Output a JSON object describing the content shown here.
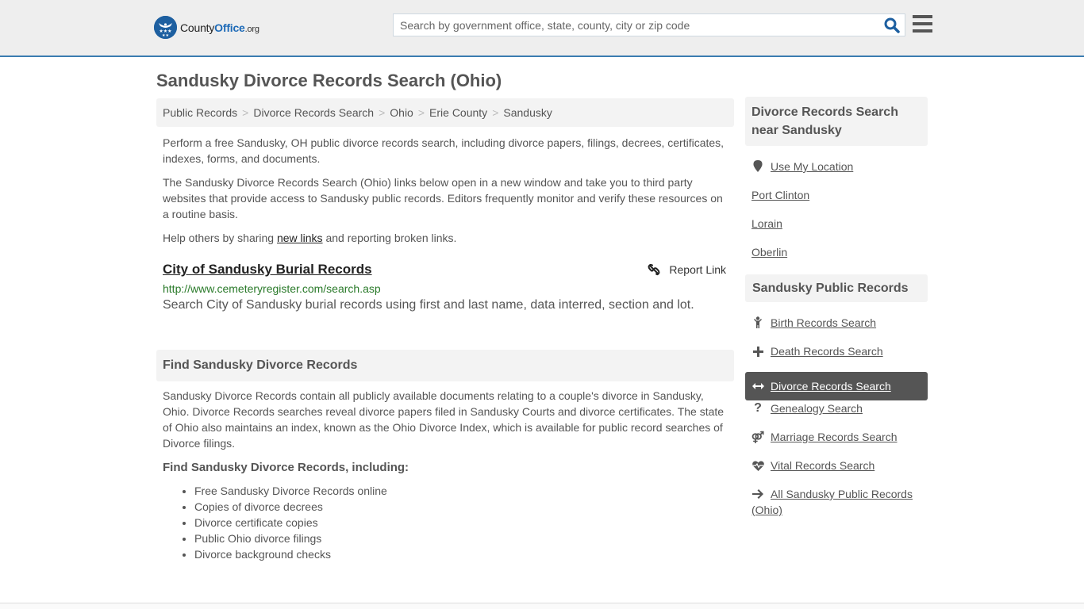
{
  "header": {
    "logo_text_1": "County",
    "logo_text_2": "Office",
    "logo_text_3": ".org",
    "search_placeholder": "Search by government office, state, county, city or zip code",
    "search_icon": "search-icon",
    "menu_icon": "hamburger-menu-icon",
    "accent_color": "#1d6ab7"
  },
  "page": {
    "title": "Sandusky Divorce Records Search (Ohio)"
  },
  "breadcrumb": [
    {
      "label": "Public Records"
    },
    {
      "label": "Divorce Records Search"
    },
    {
      "label": "Ohio"
    },
    {
      "label": "Erie County"
    },
    {
      "label": "Sandusky"
    }
  ],
  "breadcrumb_separator": ">",
  "intro": {
    "p1": "Perform a free Sandusky, OH public divorce records search, including divorce papers, filings, decrees, certificates, indexes, forms, and documents.",
    "p2": "The Sandusky Divorce Records Search (Ohio) links below open in a new window and take you to third party websites that provide access to Sandusky public records. Editors frequently monitor and verify these resources on a routine basis.",
    "p3_before": "Help others by sharing ",
    "p3_link": "new links",
    "p3_after": " and reporting broken links."
  },
  "results": [
    {
      "title": "City of Sandusky Burial Records",
      "url": "http://www.cemeteryregister.com/search.asp",
      "description": "Search City of Sandusky burial records using first and last name, data interred, section and lot.",
      "report_label": "Report Link"
    }
  ],
  "find_section": {
    "heading": "Find Sandusky Divorce Records",
    "body": "Sandusky Divorce Records contain all publicly available documents relating to a couple's divorce in Sandusky, Ohio. Divorce Records searches reveal divorce papers filed in Sandusky Courts and divorce certificates. The state of Ohio also maintains an index, known as the Ohio Divorce Index, which is available for public record searches of Divorce filings.",
    "sub_heading": "Find Sandusky Divorce Records, including:",
    "items": [
      "Free Sandusky Divorce Records online",
      "Copies of divorce decrees",
      "Divorce certificate copies",
      "Public Ohio divorce filings",
      "Divorce background checks"
    ]
  },
  "sidebar": {
    "nearby_heading": "Divorce Records Search near Sandusky",
    "use_location": "Use My Location",
    "nearby": [
      "Port Clinton",
      "Lorain",
      "Oberlin"
    ],
    "public_heading": "Sandusky Public Records",
    "public_links": [
      {
        "label": "Birth Records Search",
        "icon": "child-icon",
        "active": false
      },
      {
        "label": "Death Records Search",
        "icon": "plus-icon",
        "active": false
      },
      {
        "label": "Divorce Records Search",
        "icon": "arrows-horizontal-icon",
        "active": true
      },
      {
        "label": "Genealogy Search",
        "icon": "question-icon",
        "active": false
      },
      {
        "label": "Marriage Records Search",
        "icon": "venus-mars-icon",
        "active": false
      },
      {
        "label": "Vital Records Search",
        "icon": "heartbeat-icon",
        "active": false
      },
      {
        "label": "All Sandusky Public Records (Ohio)",
        "icon": "arrow-right-icon",
        "active": false
      }
    ]
  }
}
